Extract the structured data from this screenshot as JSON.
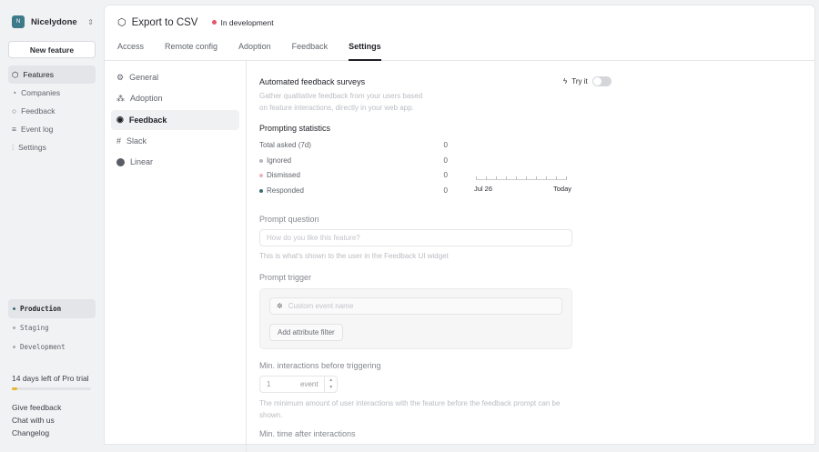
{
  "org": {
    "initial": "N",
    "name": "Nicelydone"
  },
  "sidebar": {
    "new_feature": "New feature",
    "items": [
      {
        "label": "Features",
        "icon": "cube-icon"
      },
      {
        "label": "Companies",
        "icon": "pie-icon"
      },
      {
        "label": "Feedback",
        "icon": "chat-icon"
      },
      {
        "label": "Event log",
        "icon": "list-icon"
      },
      {
        "label": "Settings",
        "icon": "sliders-icon"
      }
    ],
    "environments": [
      "Production",
      "Staging",
      "Development"
    ],
    "trial": {
      "text": "14 days left of Pro trial",
      "progress": 0.07
    },
    "links": [
      "Give feedback",
      "Chat with us",
      "Changelog"
    ]
  },
  "header": {
    "title": "Export to CSV",
    "status": "In development",
    "status_color": "#e5566b"
  },
  "tabs": [
    "Access",
    "Remote config",
    "Adoption",
    "Feedback",
    "Settings"
  ],
  "subnav": [
    "General",
    "Adoption",
    "Feedback",
    "Slack",
    "Linear"
  ],
  "surveys": {
    "title": "Automated feedback surveys",
    "description_1": "Gather qualitative feedback from your users based",
    "description_2": "on feature interactions, directly in your web app.",
    "try_it": "Try it"
  },
  "stats": {
    "title": "Prompting statistics",
    "rows": [
      {
        "label": "Total asked (7d)",
        "value": "0"
      },
      {
        "label": "Ignored",
        "value": "0",
        "color": "#b4b6bb"
      },
      {
        "label": "Dismissed",
        "value": "0",
        "color": "#e8b4ba"
      },
      {
        "label": "Responded",
        "value": "0",
        "color": "#3d6d78"
      }
    ],
    "axis_start": "Jul 26",
    "axis_end": "Today"
  },
  "prompt_question": {
    "label": "Prompt question",
    "placeholder": "How do you like this feature?",
    "help": "This is what's shown to the user in the Feedback UI widget"
  },
  "prompt_trigger": {
    "label": "Prompt trigger",
    "placeholder": "Custom event name",
    "add_filter": "Add attribute filter"
  },
  "min_interactions": {
    "label": "Min. interactions before triggering",
    "value": "1",
    "unit": "event",
    "help_1": "The minimum amount of user interactions with the feature before the feedback prompt can be",
    "help_2": "shown."
  },
  "min_time": {
    "label": "Min. time after interactions"
  }
}
